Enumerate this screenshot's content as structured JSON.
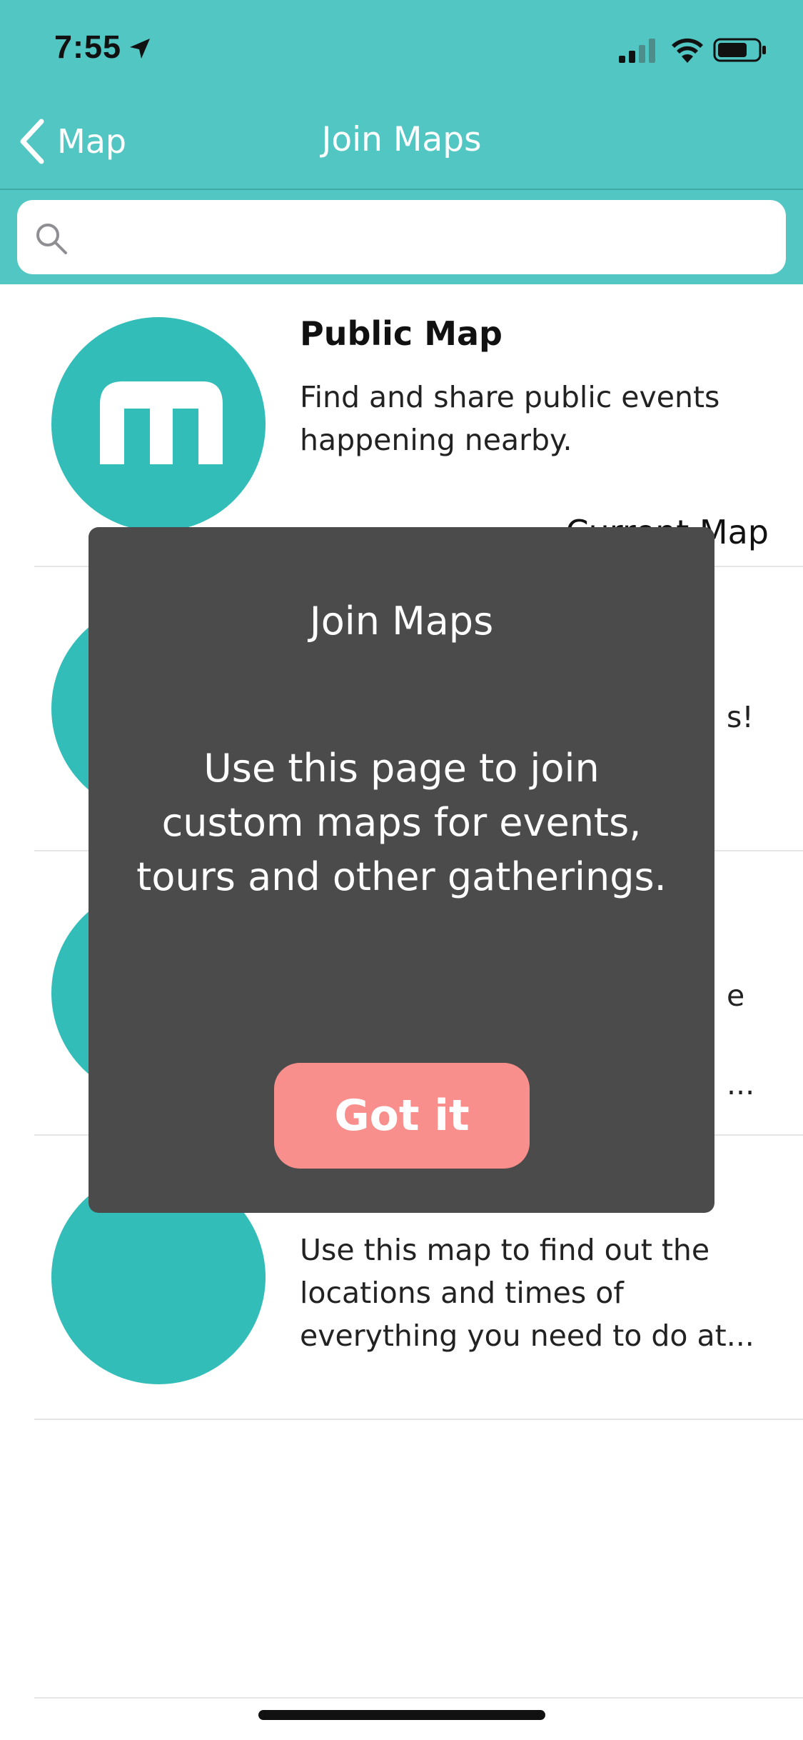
{
  "status_bar": {
    "time": "7:55",
    "location_icon": "location-arrow-icon",
    "signal_icon": "cellular-signal-icon",
    "wifi_icon": "wifi-icon",
    "battery_icon": "battery-icon"
  },
  "nav": {
    "back_label": "Map",
    "title": "Join Maps"
  },
  "search": {
    "placeholder": "",
    "value": ""
  },
  "list": {
    "items": [
      {
        "title": "Public Map",
        "description": "Find and share public events happening nearby.",
        "action": "Current Map"
      },
      {
        "title": "",
        "description": "s!"
      },
      {
        "title": "",
        "description": "e\n..."
      },
      {
        "title": "",
        "description": "Use this map to find out the locations and times of everything you need to do at..."
      }
    ]
  },
  "modal": {
    "title": "Join Maps",
    "body": "Use this page to join custom maps for events, tours and other gatherings.",
    "button_label": "Got it"
  },
  "colors": {
    "header": "#52c6c2",
    "avatar": "#33bdb8",
    "modal_bg": "#4b4b4b",
    "button": "#f88f8c"
  }
}
